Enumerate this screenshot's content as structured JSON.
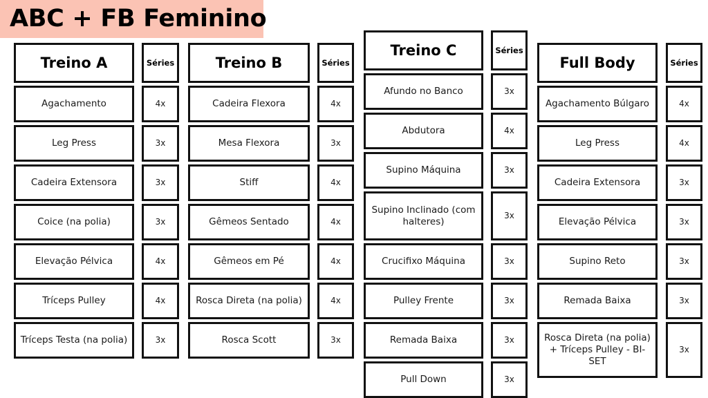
{
  "page": {
    "title": "ABC + FB Feminino",
    "banner_color": "#fbc3b4",
    "border_color": "#111111",
    "background": "#ffffff"
  },
  "sets_header_label": "Séries",
  "columns": [
    {
      "id": "treino-a",
      "title": "Treino A",
      "rows": [
        {
          "name": "Agachamento",
          "sets": "4x"
        },
        {
          "name": "Leg Press",
          "sets": "3x"
        },
        {
          "name": "Cadeira Extensora",
          "sets": "3x"
        },
        {
          "name": "Coice (na polia)",
          "sets": "3x"
        },
        {
          "name": "Elevação Pélvica",
          "sets": "4x"
        },
        {
          "name": "Tríceps Pulley",
          "sets": "4x"
        },
        {
          "name": "Tríceps Testa (na polia)",
          "sets": "3x"
        }
      ]
    },
    {
      "id": "treino-b",
      "title": "Treino B",
      "rows": [
        {
          "name": "Cadeira Flexora",
          "sets": "4x"
        },
        {
          "name": "Mesa Flexora",
          "sets": "3x"
        },
        {
          "name": "Stiff",
          "sets": "4x"
        },
        {
          "name": "Gêmeos Sentado",
          "sets": "4x"
        },
        {
          "name": "Gêmeos em Pé",
          "sets": "4x"
        },
        {
          "name": "Rosca Direta (na polia)",
          "sets": "4x"
        },
        {
          "name": "Rosca Scott",
          "sets": "3x"
        }
      ]
    },
    {
      "id": "treino-c",
      "title": "Treino C",
      "rows": [
        {
          "name": "Afundo no Banco",
          "sets": "3x"
        },
        {
          "name": "Abdutora",
          "sets": "4x"
        },
        {
          "name": "Supino Máquina",
          "sets": "3x"
        },
        {
          "name": "Supino Inclinado (com halteres)",
          "sets": "3x"
        },
        {
          "name": "Crucifixo Máquina",
          "sets": "3x"
        },
        {
          "name": "Pulley Frente",
          "sets": "3x"
        },
        {
          "name": "Remada Baixa",
          "sets": "3x"
        },
        {
          "name": "Pull Down",
          "sets": "3x"
        }
      ]
    },
    {
      "id": "full-body",
      "title": "Full Body",
      "rows": [
        {
          "name": "Agachamento Búlgaro",
          "sets": "4x"
        },
        {
          "name": "Leg Press",
          "sets": "4x"
        },
        {
          "name": "Cadeira Extensora",
          "sets": "3x"
        },
        {
          "name": "Elevação Pélvica",
          "sets": "3x"
        },
        {
          "name": "Supino Reto",
          "sets": "3x"
        },
        {
          "name": "Remada Baixa",
          "sets": "3x"
        },
        {
          "name": "Rosca Direta (na polia) + Tríceps Pulley - BI-SET",
          "sets": "3x"
        }
      ]
    }
  ]
}
